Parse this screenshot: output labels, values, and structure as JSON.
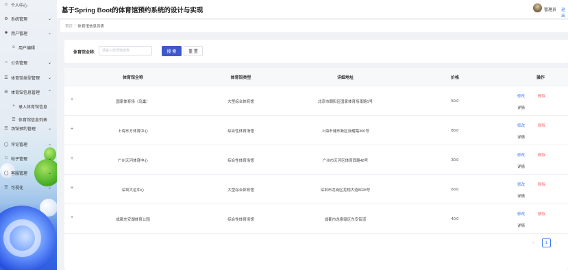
{
  "app": {
    "title": "基于Spring Boot的体育馆预约系统的设计与实现"
  },
  "header": {
    "user_name": "管理员",
    "logout_label": "退出"
  },
  "sidebar": {
    "items": [
      {
        "label": "个人中心",
        "icon": "user-icon",
        "has_chevron": false
      },
      {
        "label": "系统管理",
        "icon": "gear-icon",
        "has_chevron": true
      },
      {
        "label": "用户管理",
        "icon": "users-icon",
        "has_chevron": true
      },
      {
        "label": "用户编辑",
        "icon": "user-icon",
        "has_chevron": false
      },
      {
        "label": "公告管理",
        "icon": "bell-icon",
        "has_chevron": true
      },
      {
        "label": "体育馆类型管理",
        "icon": "list-icon",
        "has_chevron": true
      },
      {
        "label": "体育馆信息管理",
        "icon": "list-icon",
        "has_chevron": true,
        "chevron": "up"
      },
      {
        "label": "录入体育馆信息",
        "icon": "plus-icon",
        "has_chevron": false
      },
      {
        "label": "体育馆信息列表",
        "icon": "list-icon",
        "has_chevron": false
      },
      {
        "label": "场馆预约管理",
        "icon": "list-icon",
        "has_chevron": true
      },
      {
        "label": "评论管理",
        "icon": "comment-icon",
        "has_chevron": true
      },
      {
        "label": "帖子管理",
        "icon": "post-icon",
        "has_chevron": true
      },
      {
        "label": "客服管理",
        "icon": "service-icon",
        "has_chevron": true
      },
      {
        "label": "可视化",
        "icon": "chart-icon",
        "has_chevron": true
      }
    ]
  },
  "breadcrumb": {
    "home": "首页",
    "separator": "/",
    "current": "体育馆信息列表"
  },
  "search": {
    "label": "体育馆全称:",
    "placeholder": "请输入体育馆全称",
    "search_label": "搜 索",
    "reset_label": "重 置"
  },
  "table": {
    "columns": [
      "体育馆全称",
      "体育馆类型",
      "详细地址",
      "价格",
      "操作"
    ],
    "rows": [
      {
        "name": "国家体育场（鸟巢）",
        "type": "大型综合体育馆",
        "address": "北京市朝阳区国家体育场南路1号",
        "price": "50.0"
      },
      {
        "name": "上海东方体育中心",
        "type": "综合性体育场馆",
        "address": "上海市浦东新区泳耀路300号",
        "price": "80.0"
      },
      {
        "name": "广州天河体育中心",
        "type": "综合性体育场馆",
        "address": "广州市天河区体育西路48号",
        "price": "30.0"
      },
      {
        "name": "深圳大运中心",
        "type": "大型综合体育馆",
        "address": "深圳市龙岗区龙翔大道8028号",
        "price": "60.0"
      },
      {
        "name": "成都东安湖体育公园",
        "type": "综合性体育场馆",
        "address": "成都市龙泉驿区东安街道",
        "price": "40.0"
      }
    ],
    "actions": {
      "edit": "修改",
      "delete": "删除",
      "detail": "详情"
    },
    "expand_symbol": "+"
  },
  "pagination": {
    "current_page": "1",
    "prev_symbol": "‹",
    "next_symbol": "›"
  },
  "colors": {
    "primary": "#4059c8",
    "link": "#3a7af2",
    "danger": "#f56c6c"
  }
}
